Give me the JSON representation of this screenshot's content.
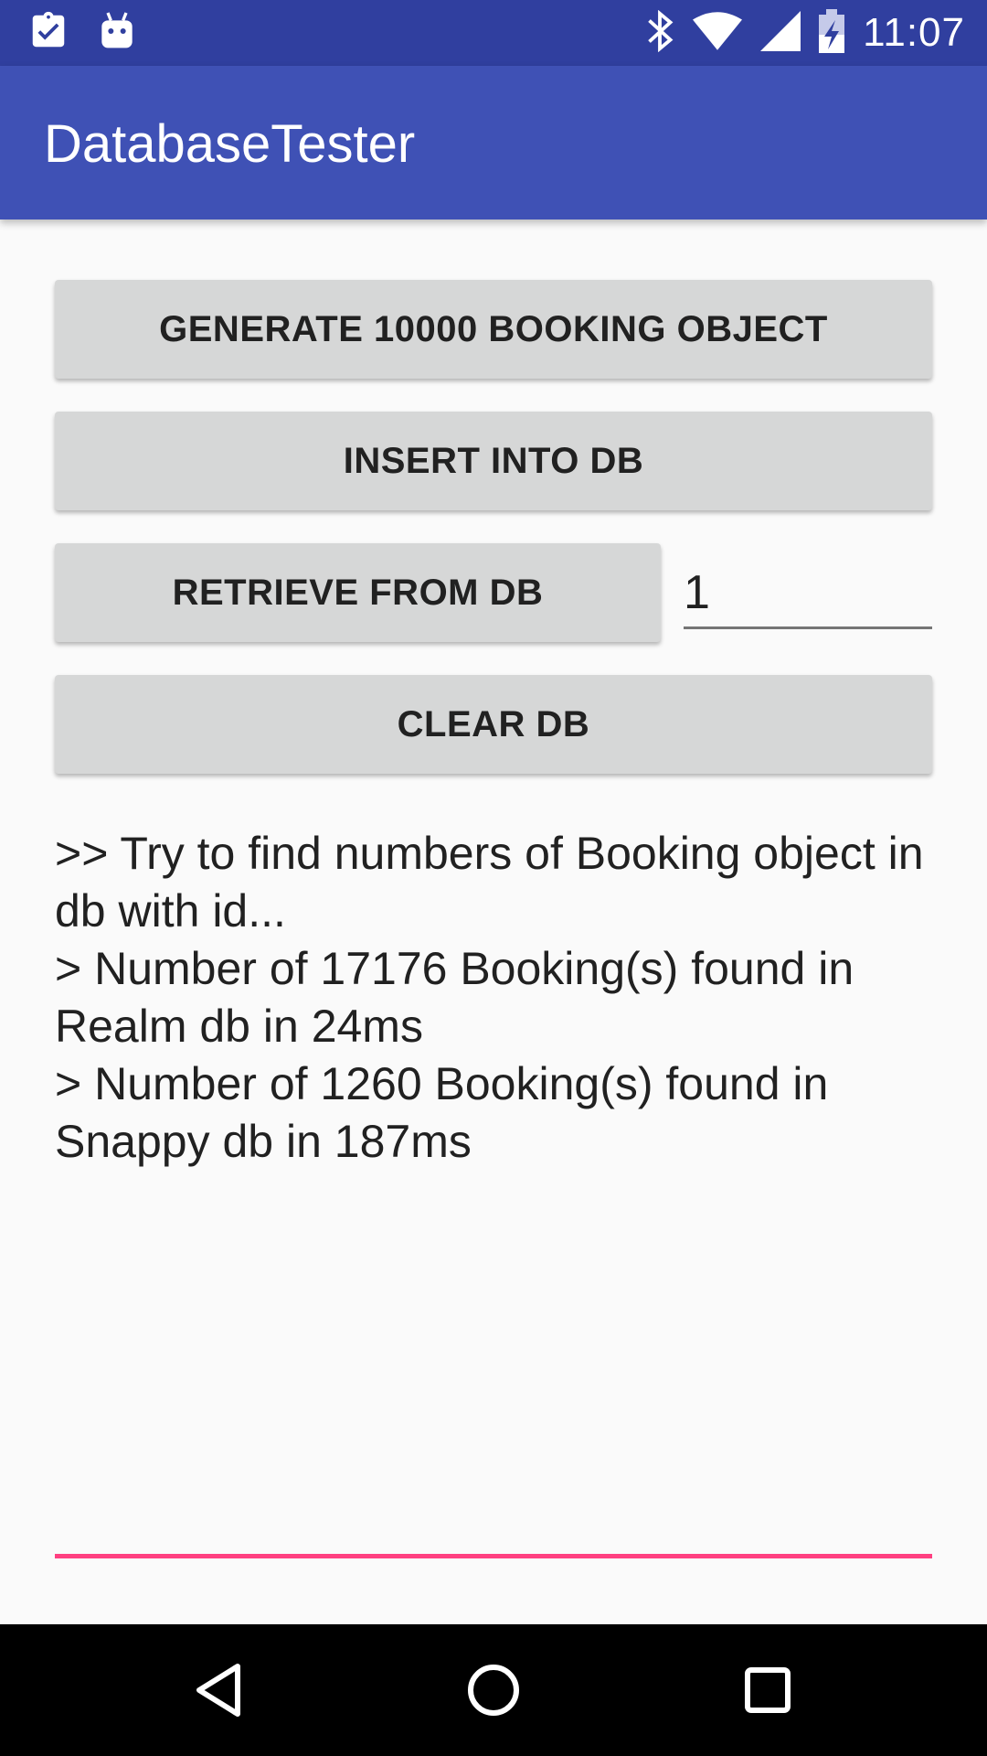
{
  "status_bar": {
    "time": "11:07",
    "icons_left": [
      "clipboard-check-icon",
      "android-icon"
    ],
    "icons_right": [
      "bluetooth-icon",
      "wifi-icon",
      "signal-icon",
      "battery-icon"
    ]
  },
  "app_bar": {
    "title": "DatabaseTester",
    "color": "#3f51b5"
  },
  "buttons": {
    "generate": "GENERATE 10000 BOOKING OBJECT",
    "insert": "INSERT INTO DB",
    "retrieve": "RETRIEVE FROM DB",
    "clear": "CLEAR DB"
  },
  "id_input": {
    "value": "1"
  },
  "log": {
    "lines": [
      ">> Try to find numbers of Booking object in db with id...",
      "> Number of 17176 Booking(s) found in Realm db in 24ms",
      "> Number of 1260 Booking(s) found in Snappy db in 187ms"
    ]
  },
  "accent_color": "#ff4081",
  "nav_bar": {
    "icons": [
      "back-icon",
      "home-icon",
      "recents-icon"
    ]
  }
}
